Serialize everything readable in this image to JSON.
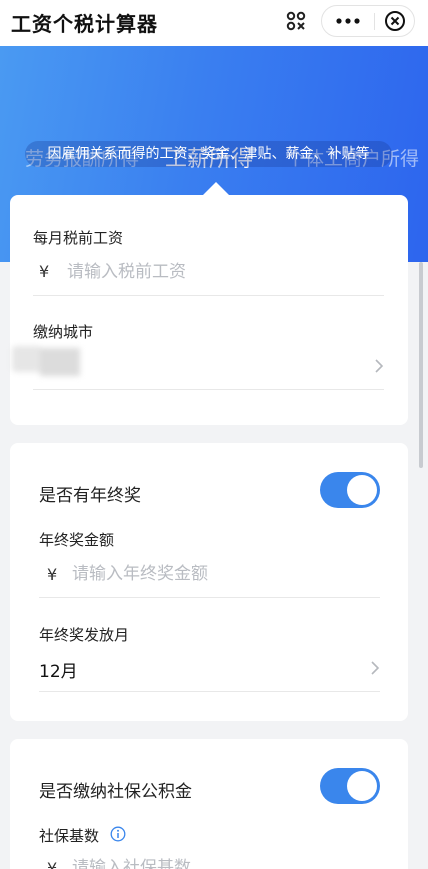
{
  "header": {
    "title": "工资个税计算器"
  },
  "tabs": [
    {
      "label": "劳务报酬所得",
      "active": false
    },
    {
      "label": "工薪所得",
      "active": true
    },
    {
      "label": "个体工商户所得",
      "active": false
    }
  ],
  "tab_description": "因雇佣关系而得的工资、奖金、津贴、薪金、补贴等",
  "salary_card": {
    "salary_label": "每月税前工资",
    "currency": "¥",
    "salary_placeholder": "请输入税前工资",
    "salary_value": "",
    "city_label": "缴纳城市",
    "city_value": ""
  },
  "bonus_card": {
    "toggle_label": "是否有年终奖",
    "toggle_on": true,
    "amount_label": "年终奖金额",
    "currency": "¥",
    "amount_placeholder": "请输入年终奖金额",
    "amount_value": "",
    "month_label": "年终奖发放月",
    "month_value": "12月"
  },
  "social_card": {
    "toggle_label": "是否缴纳社保公积金",
    "toggle_on": true,
    "base_label": "社保基数",
    "currency": "¥",
    "base_placeholder": "请输入社保基数"
  },
  "colors": {
    "banner_start": "#4a9af2",
    "banner_end": "#2d65ee",
    "toggle_on": "#3a86ec",
    "info_icon": "#3a86ec"
  },
  "icons": {
    "scan": "scan-icon",
    "more": "more-icon",
    "close": "close-circle-icon",
    "chevron": "chevron-right-icon",
    "info": "info-icon"
  }
}
